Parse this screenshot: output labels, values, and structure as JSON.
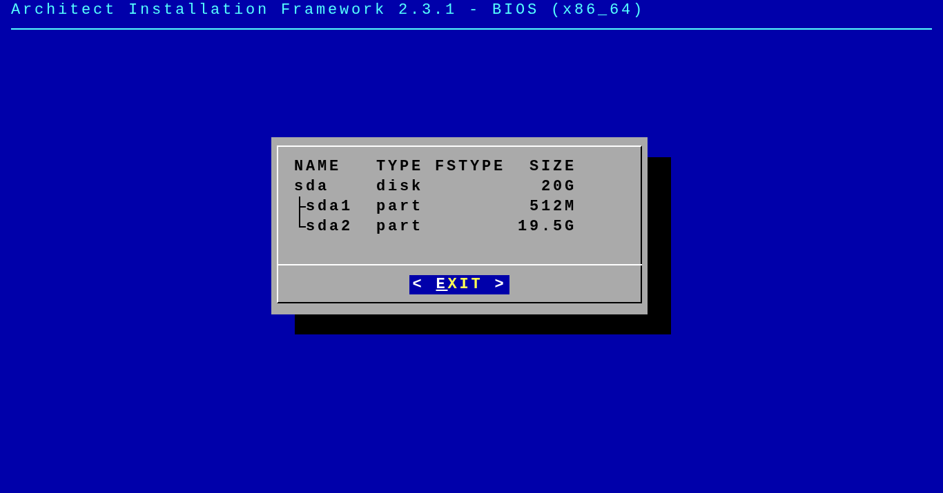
{
  "title": "Architect Installation Framework 2.3.1 - BIOS (x86_64)",
  "table": {
    "columns": [
      "NAME",
      "TYPE",
      "FSTYPE",
      "SIZE"
    ],
    "rows": [
      {
        "name": "sda",
        "type": "disk",
        "size": "20G",
        "children": [
          {
            "name": "sda1",
            "type": "part",
            "size": "512M"
          },
          {
            "name": "sda2",
            "type": "part",
            "size": "19.5G"
          }
        ]
      }
    ]
  },
  "buttons": [
    {
      "label": "EXIT",
      "left_marker": "<",
      "right_marker": ">",
      "selected": true
    }
  ]
}
